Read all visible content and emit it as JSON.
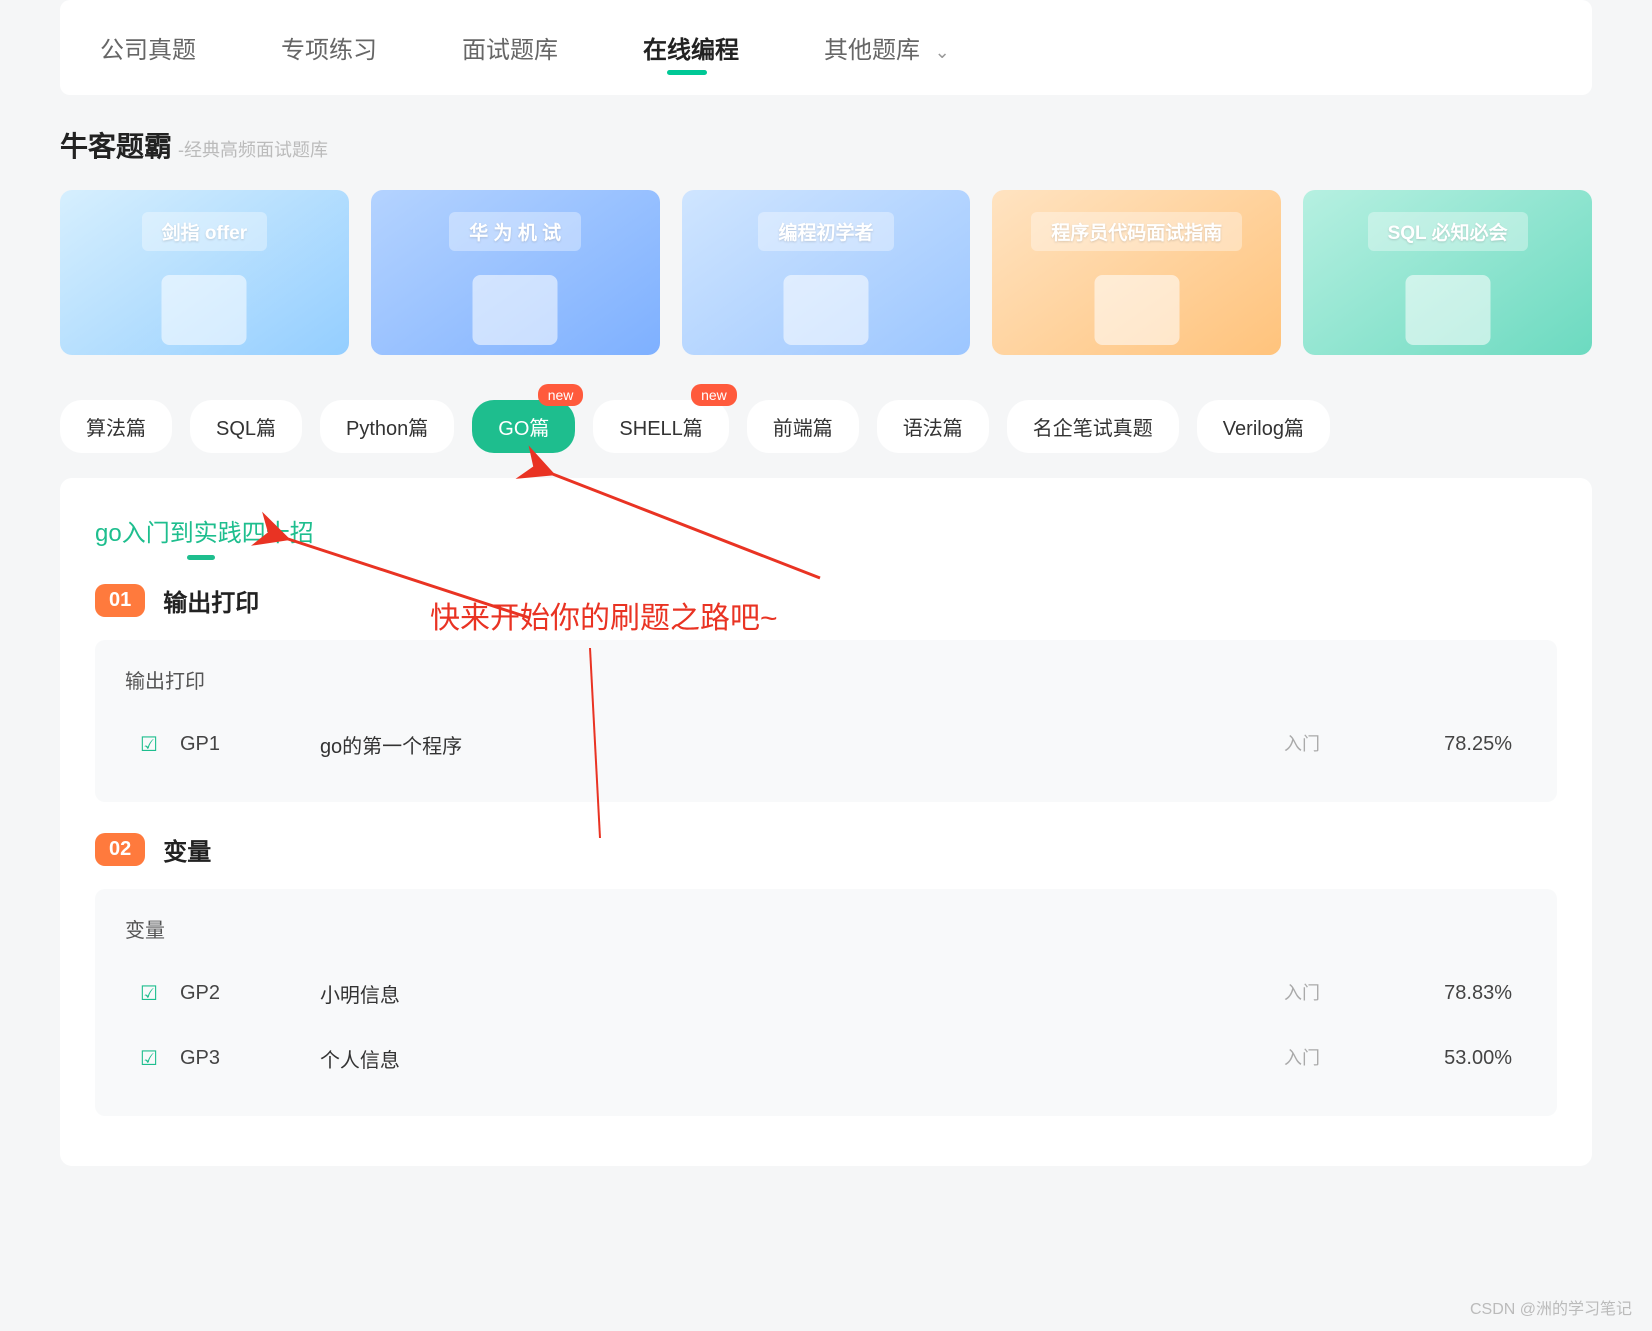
{
  "top_nav": {
    "items": [
      "公司真题",
      "专项练习",
      "面试题库",
      "在线编程",
      "其他题库"
    ],
    "active_index": 3
  },
  "section": {
    "title": "牛客题霸",
    "subtitle": "-经典高频面试题库"
  },
  "cards": [
    {
      "label": "剑指 offer"
    },
    {
      "label": "华 为 机 试"
    },
    {
      "label": "编程初学者"
    },
    {
      "label": "程序员代码面试指南"
    },
    {
      "label": "SQL 必知必会"
    }
  ],
  "filters": [
    {
      "label": "算法篇",
      "badge": ""
    },
    {
      "label": "SQL篇",
      "badge": ""
    },
    {
      "label": "Python篇",
      "badge": ""
    },
    {
      "label": "GO篇",
      "badge": "new",
      "active": true
    },
    {
      "label": "SHELL篇",
      "badge": "new"
    },
    {
      "label": "前端篇",
      "badge": ""
    },
    {
      "label": "语法篇",
      "badge": ""
    },
    {
      "label": "名企笔试真题",
      "badge": ""
    },
    {
      "label": "Verilog篇",
      "badge": ""
    }
  ],
  "panel_title": "go入门到实践四十招",
  "annotation_text": "快来开始你的刷题之路吧~",
  "chapters": [
    {
      "num": "01",
      "title": "输出打印",
      "sub": "输出打印",
      "problems": [
        {
          "id": "GP1",
          "title": "go的第一个程序",
          "level": "入门",
          "rate": "78.25%"
        }
      ]
    },
    {
      "num": "02",
      "title": "变量",
      "sub": "变量",
      "problems": [
        {
          "id": "GP2",
          "title": "小明信息",
          "level": "入门",
          "rate": "78.83%"
        },
        {
          "id": "GP3",
          "title": "个人信息",
          "level": "入门",
          "rate": "53.00%"
        }
      ]
    }
  ],
  "watermark": "CSDN @洲的学习笔记"
}
